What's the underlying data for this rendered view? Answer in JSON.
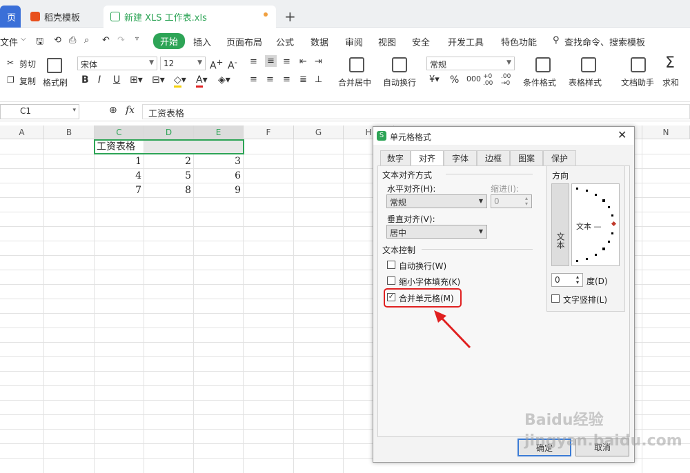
{
  "tabs": [
    {
      "label": "页"
    },
    {
      "label": "稻壳模板"
    },
    {
      "label": "新建 XLS 工作表.xls"
    }
  ],
  "new_tab": "+",
  "menu": {
    "file": "文件",
    "items": [
      "开始",
      "插入",
      "页面布局",
      "公式",
      "数据",
      "审阅",
      "视图",
      "安全",
      "开发工具",
      "特色功能"
    ],
    "search": "查找命令、搜索模板"
  },
  "toolbar": {
    "cut": "剪切",
    "copy": "复制",
    "format_painter": "格式刷",
    "font": "宋体",
    "size": "12",
    "merge": "合并居中",
    "wrap": "自动换行",
    "number_format": "常规",
    "cond_format": "条件格式",
    "table_style": "表格样式",
    "doc_helper": "文档助手",
    "sum": "求和"
  },
  "formula_bar": {
    "cell_ref": "C1",
    "fx": "fx",
    "value": "工资表格"
  },
  "columns": [
    "A",
    "B",
    "C",
    "D",
    "E",
    "F",
    "G",
    "H",
    "N"
  ],
  "cells": {
    "title": "工资表格",
    "rows": [
      [
        "1",
        "2",
        "3"
      ],
      [
        "4",
        "5",
        "6"
      ],
      [
        "7",
        "8",
        "9"
      ]
    ]
  },
  "dialog": {
    "title": "单元格格式",
    "tabs": [
      "数字",
      "对齐",
      "字体",
      "边框",
      "图案",
      "保护"
    ],
    "text_align_section": "文本对齐方式",
    "h_align_label": "水平对齐(H):",
    "h_align_value": "常规",
    "indent_label": "缩进(I):",
    "indent_value": "0",
    "v_align_label": "垂直对齐(V):",
    "v_align_value": "居中",
    "text_control_section": "文本控制",
    "wrap_label": "自动换行(W)",
    "shrink_label": "缩小字体填充(K)",
    "merge_label": "合并单元格(M)",
    "merge_checked": true,
    "direction_section": "方向",
    "vertical_text": "文本",
    "orientation_text": "文本 —",
    "degree_value": "0",
    "degree_label": "度(D)",
    "vertical_layout_label": "文字竖排(L)",
    "ok": "确定",
    "cancel": "取消"
  },
  "watermark": "Baidu经验 jingyan.baidu.com",
  "colors": {
    "accent": "#2da456",
    "highlight": "#e02020"
  }
}
